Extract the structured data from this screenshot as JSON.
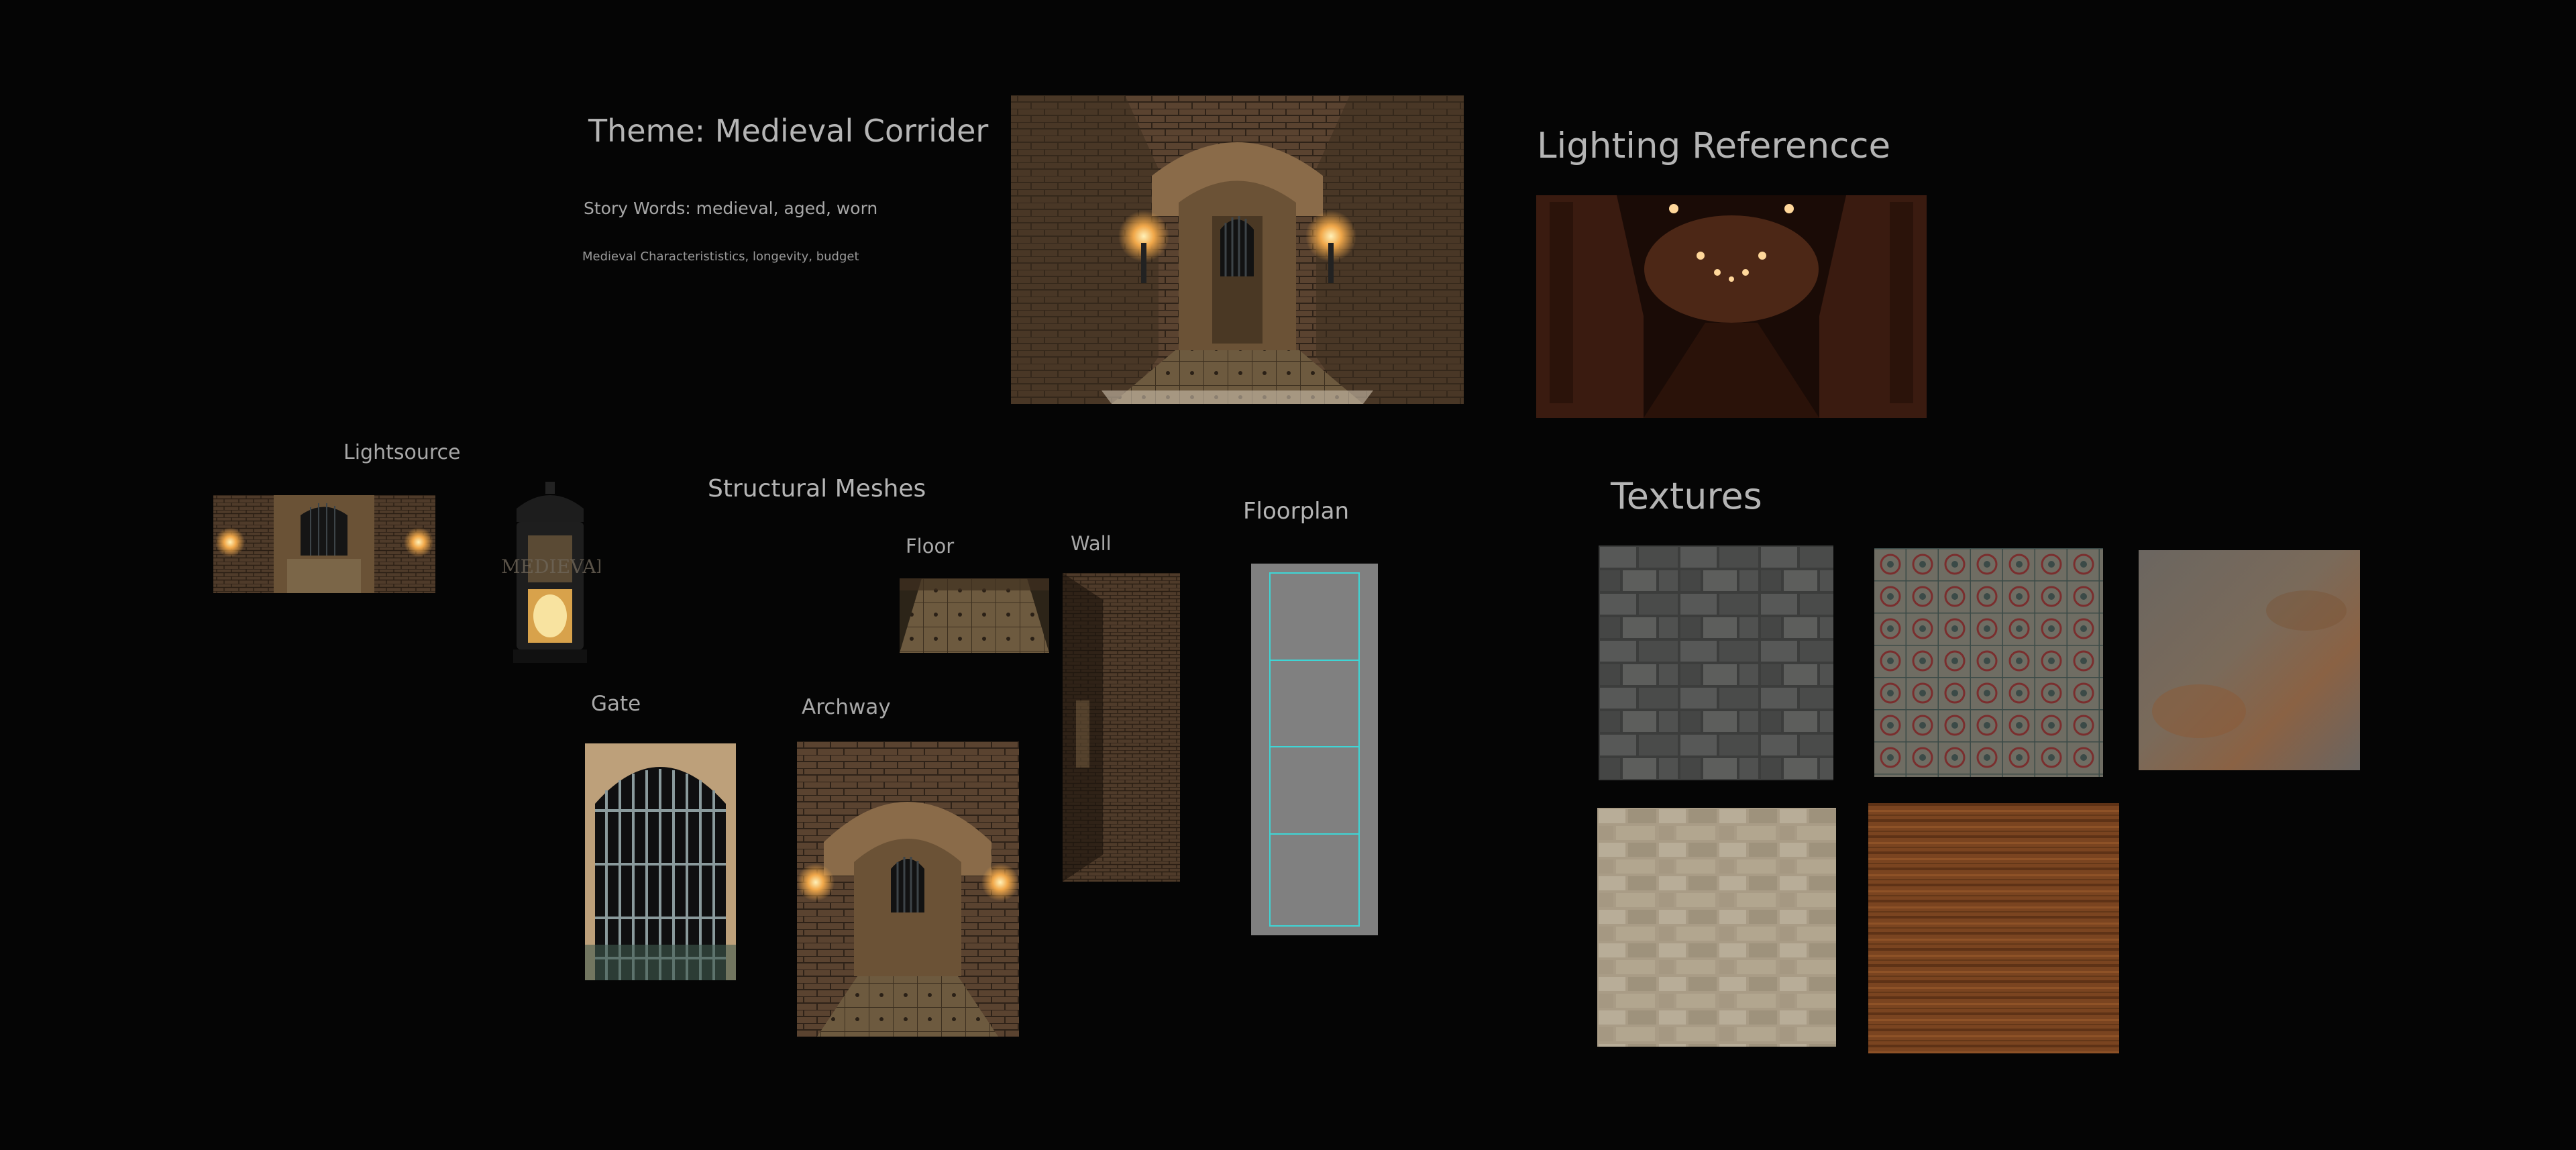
{
  "header": {
    "theme_title": "Theme: Medieval Corrider",
    "story_words": "Story Words: medieval, aged, worn",
    "characteristics": "Medieval Characterististics, longevity, budget"
  },
  "lighting": {
    "title": "Lighting Referencce"
  },
  "lightsource": {
    "label": "Lightsource",
    "lantern_watermark": "MEDIEVAL"
  },
  "structural": {
    "title": "Structural Meshes",
    "floor_label": "Floor",
    "wall_label": "Wall",
    "gate_label": "Gate",
    "archway_label": "Archway",
    "floorplan_label": "Floorplan"
  },
  "textures": {
    "title": "Textures",
    "items": [
      "stone-wall-texture",
      "tile-floor-texture",
      "rusted-metal-texture",
      "sandstone-brick-texture",
      "wood-plank-texture"
    ]
  },
  "colors": {
    "background": "#050505",
    "label_text": "#bdbdbd",
    "floorplan_grid": "#3ed6d6",
    "floorplan_fill": "#808080"
  }
}
